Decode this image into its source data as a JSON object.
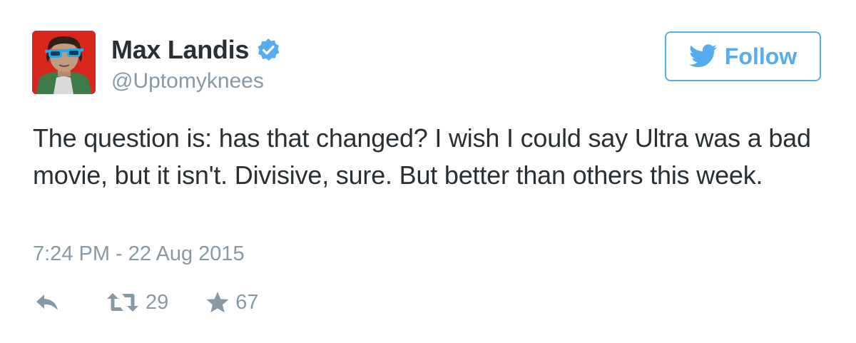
{
  "tweet": {
    "author": {
      "display_name": "Max Landis",
      "handle": "@Uptomyknees",
      "verified": true,
      "avatar_icon": "avatar-portrait"
    },
    "follow_button": {
      "label": "Follow",
      "icon": "twitter-bird-icon"
    },
    "text": "The question is: has that changed? I wish I could say Ultra was a bad movie, but it isn't. Divisive, sure. But better than others this week.",
    "timestamp": "7:24 PM - 22 Aug 2015",
    "actions": {
      "reply": {
        "icon": "reply-icon"
      },
      "retweet": {
        "icon": "retweet-icon",
        "count": "29"
      },
      "favorite": {
        "icon": "star-icon",
        "count": "67"
      }
    }
  },
  "colors": {
    "text": "#292f33",
    "muted": "#8899a6",
    "accent": "#55acee",
    "verified": "#55acee",
    "avatar_bg": "#d9261c"
  }
}
